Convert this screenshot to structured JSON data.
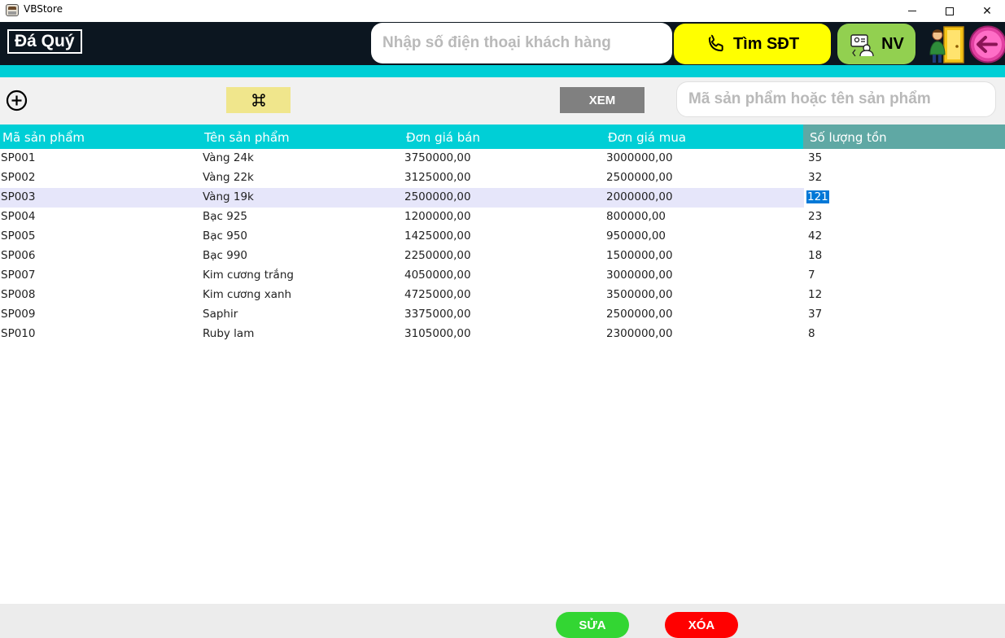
{
  "window": {
    "title": "VBStore",
    "icon": "app-icon",
    "controls": {
      "minimize": "minimize-icon",
      "maximize": "maximize-icon",
      "close": "✕"
    }
  },
  "header": {
    "brand": "Đá Quý",
    "phone_placeholder": "Nhập số điện thoại khách hàng",
    "find_button": "Tìm SĐT",
    "staff_button": "NV",
    "colors": {
      "header_bg": "#0c1620",
      "accent": "#00cfd6",
      "find_bg": "#ffff00",
      "staff_bg": "#92d050"
    }
  },
  "toolbar": {
    "view_button": "XEM",
    "search_placeholder": "Mã sản phẩm hoặc tên sản phẩm"
  },
  "table": {
    "columns": [
      "Mã sản phẩm",
      "Tên sản phẩm",
      "Đơn giá bán",
      "Đơn giá mua",
      "Số lượng tồn"
    ],
    "selected_row": 2,
    "rows": [
      [
        "SP001",
        "Vàng 24k",
        "3750000,00",
        "3000000,00",
        "35"
      ],
      [
        "SP002",
        "Vàng 22k",
        "3125000,00",
        "2500000,00",
        "32"
      ],
      [
        "SP003",
        "Vàng 19k",
        "2500000,00",
        "2000000,00",
        "121"
      ],
      [
        "SP004",
        "Bạc 925",
        "1200000,00",
        "800000,00",
        "23"
      ],
      [
        "SP005",
        "Bạc 950",
        "1425000,00",
        "950000,00",
        "42"
      ],
      [
        "SP006",
        "Bạc 990",
        "2250000,00",
        "1500000,00",
        "18"
      ],
      [
        "SP007",
        "Kim cương trắng",
        "4050000,00",
        "3000000,00",
        "7"
      ],
      [
        "SP008",
        "Kim cương xanh",
        "4725000,00",
        "3500000,00",
        "12"
      ],
      [
        "SP009",
        "Saphir",
        "3375000,00",
        "2500000,00",
        "37"
      ],
      [
        "SP010",
        "Ruby lam",
        "3105000,00",
        "2300000,00",
        "8"
      ]
    ]
  },
  "footer": {
    "edit_button": "SỬA",
    "delete_button": "XÓA",
    "colors": {
      "edit_bg": "#33d633",
      "delete_bg": "#ff0000"
    }
  }
}
